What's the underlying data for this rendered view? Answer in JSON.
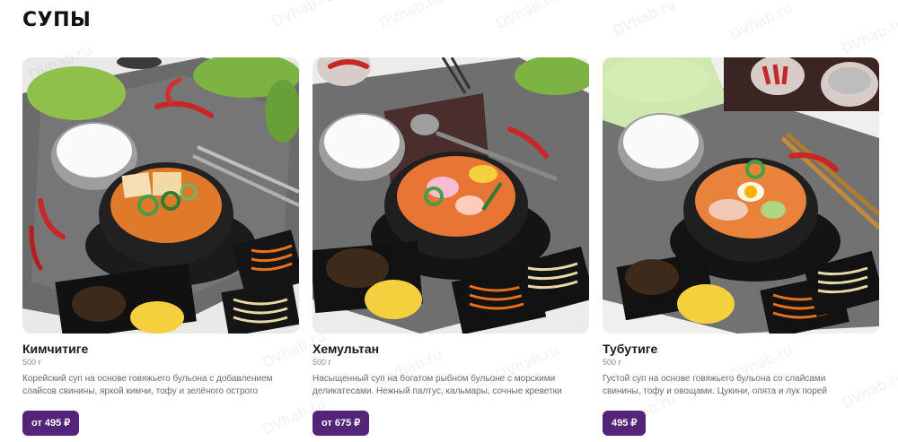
{
  "section": {
    "title": "СУПЫ"
  },
  "watermark": "DVhab.ru",
  "colors": {
    "accent": "#53247a"
  },
  "products": [
    {
      "name": "Кимчитиге",
      "weight": "500 г",
      "description_lines": [
        "Корейский суп на основе говяжьего бульона с добавлением",
        "слайсов свинины, яркой кимчи, тофу и зелёного острого"
      ],
      "price": "от 495 ₽"
    },
    {
      "name": "Хемультан",
      "weight": "500 г",
      "description_lines": [
        "Насыщенный суп на богатом рыбном бульоне с морскими",
        "деликатесами. Нежный палтус, кальмары, сочные креветки"
      ],
      "price": "от 675 ₽"
    },
    {
      "name": "Тубутиге",
      "weight": "500 г",
      "description_lines": [
        "Густой суп на основе говяжьего бульона со слайсами",
        "свинины, тофу и овощами. Цукини, опята и лук порей"
      ],
      "price": "495 ₽"
    }
  ]
}
